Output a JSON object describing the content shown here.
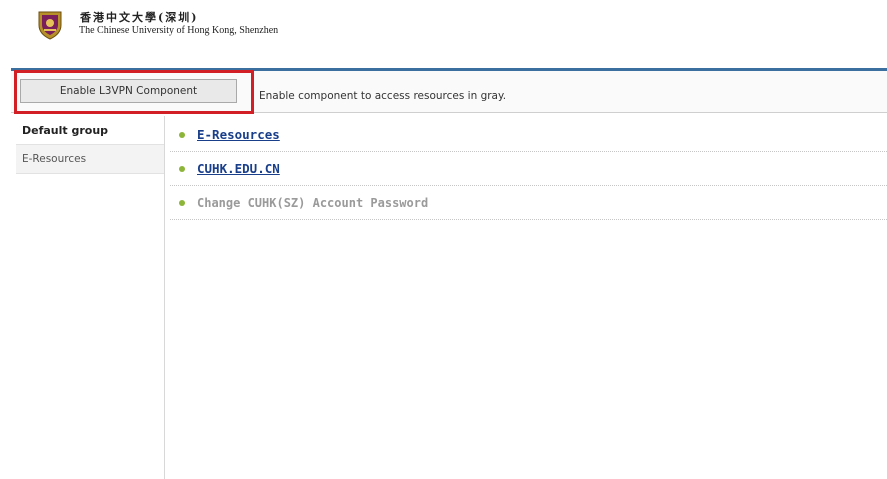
{
  "header": {
    "university_name_cn": "香港中文大學(深圳)",
    "university_name_en": "The Chinese University of Hong Kong, Shenzhen",
    "logo_icon": "university-crest-icon"
  },
  "toolbar": {
    "enable_button_label": "Enable L3VPN Component",
    "hint_text": "Enable component to access resources in gray.",
    "highlight_color": "#d21e25"
  },
  "sidebar": {
    "tabs": [
      {
        "label": "Default group",
        "active": true
      },
      {
        "label": "E-Resources",
        "active": false
      }
    ]
  },
  "resources": [
    {
      "label": "E-Resources",
      "enabled": true
    },
    {
      "label": "CUHK.EDU.CN",
      "enabled": true
    },
    {
      "label": "Change CUHK(SZ) Account Password",
      "enabled": false
    }
  ],
  "colors": {
    "accent_rule": "#3b6fa0",
    "link": "#1a3f8a",
    "disabled_text": "#9a9a9a",
    "bullet": "#8db53a"
  }
}
